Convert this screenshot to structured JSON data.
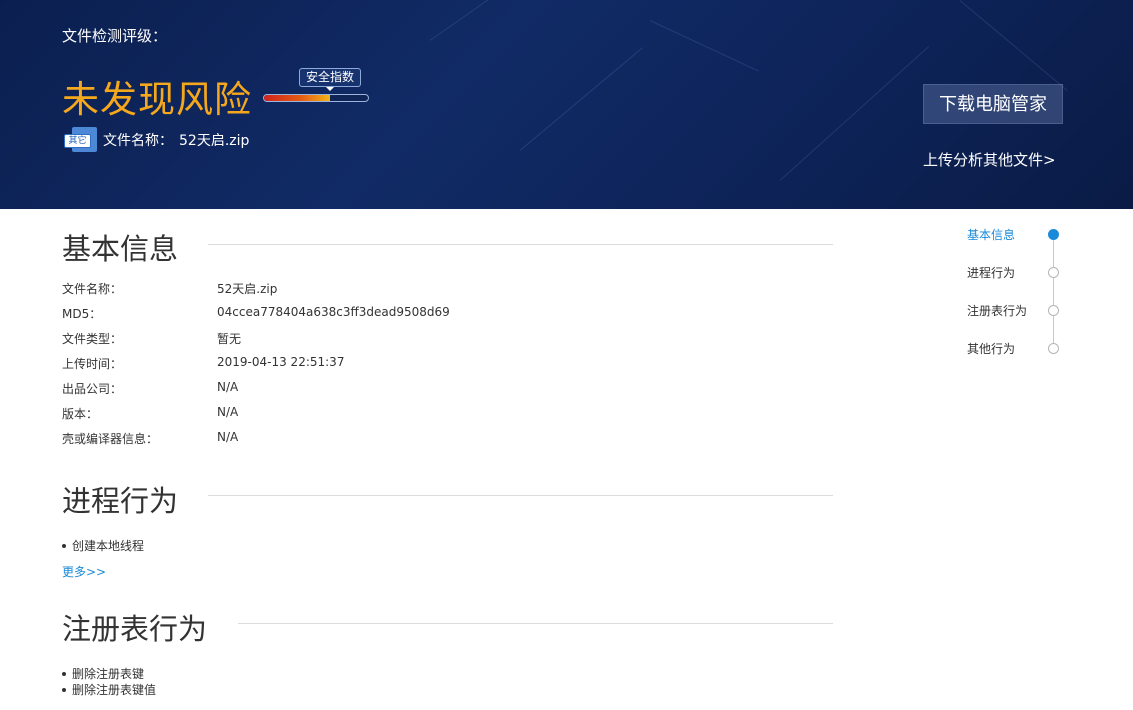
{
  "header": {
    "label": "文件检测评级：",
    "risk_result": "未发现风险",
    "safety_index_label": "安全指数",
    "safety_index_fraction": 0.63,
    "file_icon_badge": "其它",
    "file_name_label": "文件名称：",
    "file_name_value": "52天启.zip",
    "download_button": "下载电脑管家",
    "upload_link": "上传分析其他文件>"
  },
  "sections": {
    "basic": {
      "title": "基本信息",
      "rows": [
        {
          "key": "文件名称：",
          "value": "52天启.zip"
        },
        {
          "key": "MD5：",
          "value": "04ccea778404a638c3ff3dead9508d69"
        },
        {
          "key": "文件类型：",
          "value": "暂无"
        },
        {
          "key": "上传时间：",
          "value": "2019-04-13 22:51:37"
        },
        {
          "key": "出品公司：",
          "value": "N/A"
        },
        {
          "key": "版本：",
          "value": "N/A"
        },
        {
          "key": "壳或编译器信息：",
          "value": "N/A"
        }
      ]
    },
    "process": {
      "title": "进程行为",
      "items": [
        "创建本地线程"
      ],
      "more": "更多>>"
    },
    "registry": {
      "title": "注册表行为",
      "items": [
        "删除注册表键",
        "删除注册表键值"
      ]
    }
  },
  "side_nav": {
    "items": [
      {
        "label": "基本信息",
        "active": true
      },
      {
        "label": "进程行为",
        "active": false
      },
      {
        "label": "注册表行为",
        "active": false
      },
      {
        "label": "其他行为",
        "active": false
      }
    ]
  },
  "colors": {
    "banner_bg": "#112b66",
    "risk_text": "#f5a81c",
    "accent_blue": "#1a8ad8"
  }
}
